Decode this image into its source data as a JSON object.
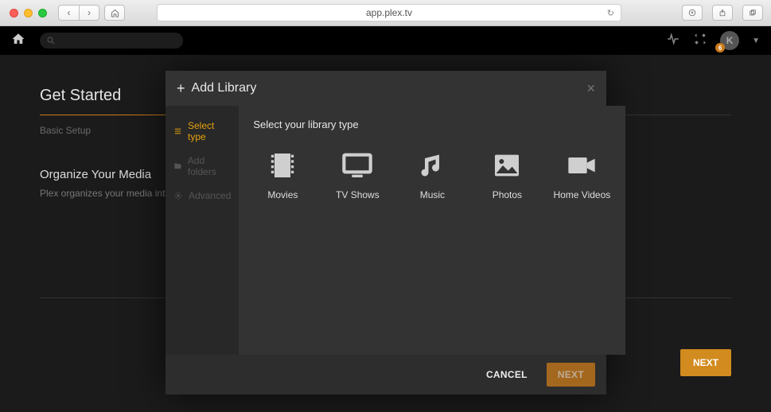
{
  "browser": {
    "url": "app.plex.tv"
  },
  "appbar": {
    "avatar_letter": "K",
    "badge_count": "6"
  },
  "page": {
    "heading": "Get Started",
    "breadcrumb": "Basic Setup",
    "section_title": "Organize Your Media",
    "section_text": "Plex organizes your media into",
    "next_label": "NEXT"
  },
  "modal": {
    "title": "Add Library",
    "steps": {
      "select_type": "Select type",
      "add_folders": "Add folders",
      "advanced": "Advanced"
    },
    "prompt": "Select your library type",
    "types": {
      "movies": "Movies",
      "tv": "TV Shows",
      "music": "Music",
      "photos": "Photos",
      "home": "Home Videos"
    },
    "cancel": "CANCEL",
    "next": "NEXT"
  }
}
